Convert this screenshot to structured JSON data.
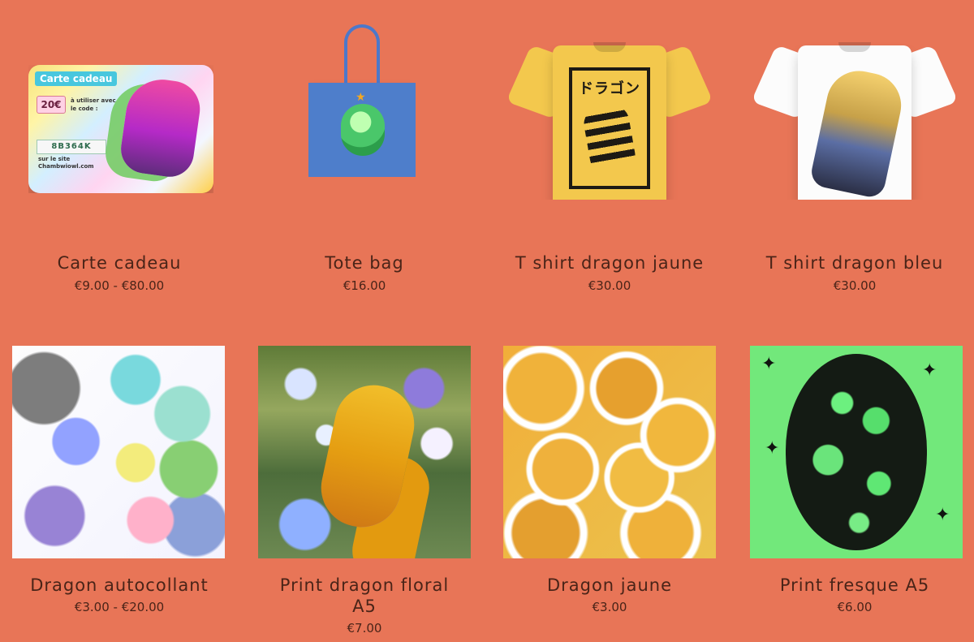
{
  "products": [
    {
      "name": "Carte cadeau",
      "price": "€9.00 - €80.00",
      "media": {
        "type": "gift-card",
        "title": "Carte cadeau",
        "value": "20€",
        "line1": "à utiliser avec",
        "line2": "le code :",
        "code": "8B364K",
        "line3": "sur le site",
        "line4": "Chambwiowl.com"
      }
    },
    {
      "name": "Tote bag",
      "price": "€16.00",
      "media": {
        "type": "tote-bag"
      }
    },
    {
      "name": "T shirt dragon jaune",
      "price": "€30.00",
      "media": {
        "type": "t-shirt-yellow",
        "print_text": "ドラゴン"
      }
    },
    {
      "name": "T shirt dragon bleu",
      "price": "€30.00",
      "media": {
        "type": "t-shirt-white"
      }
    },
    {
      "name": "Dragon autocollant",
      "price": "€3.00 - €20.00",
      "media": {
        "type": "sticker-collage"
      }
    },
    {
      "name": "Print dragon floral\nA5",
      "name_line1": "Print dragon floral",
      "name_line2": "A5",
      "price": "€7.00",
      "media": {
        "type": "floral-print"
      }
    },
    {
      "name": "Dragon jaune",
      "price": "€3.00",
      "media": {
        "type": "yellow-pattern"
      }
    },
    {
      "name": "Print fresque A5",
      "price": "€6.00",
      "media": {
        "type": "fresco-print"
      }
    }
  ],
  "colors": {
    "background": "#e87557",
    "text": "#4a2418"
  }
}
